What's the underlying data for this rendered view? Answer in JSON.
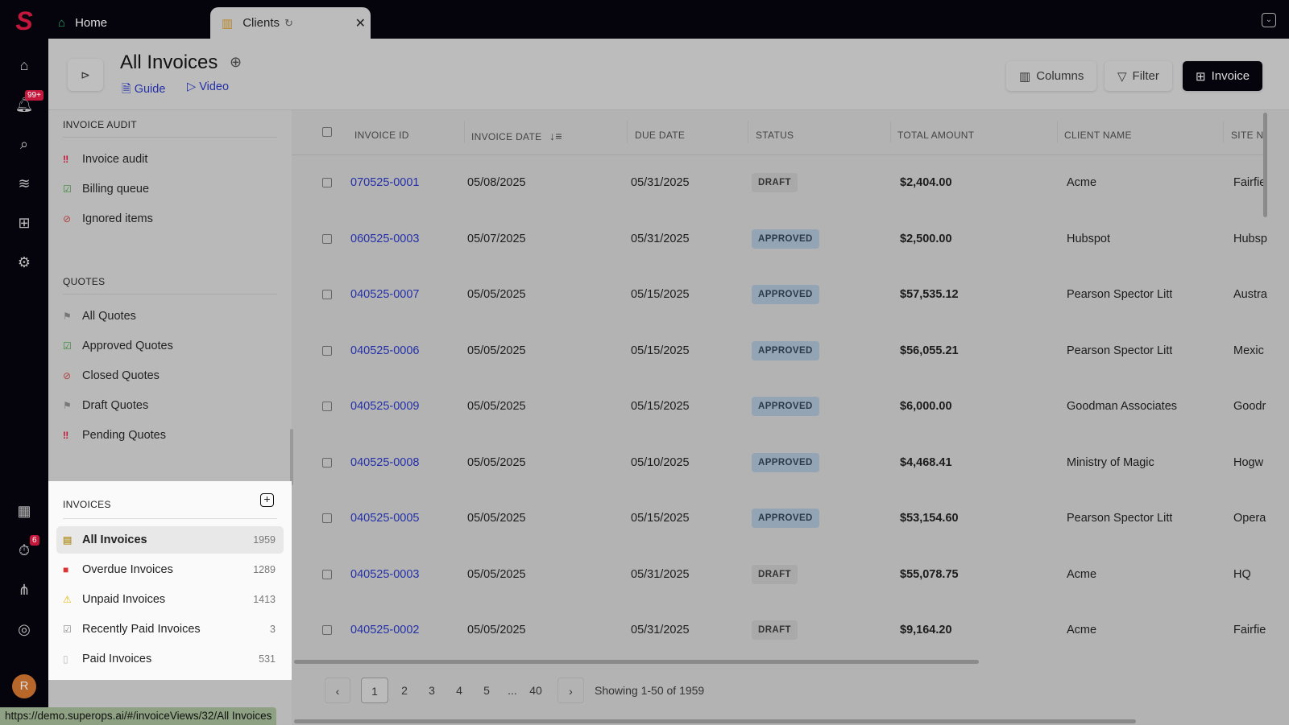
{
  "tabs": [
    {
      "label": "Home"
    },
    {
      "label": "Clients"
    }
  ],
  "rail": {
    "notif_badge": "99+",
    "timer_badge": "6",
    "avatar": "R"
  },
  "page": {
    "title": "All Invoices",
    "guide": "Guide",
    "video": "Video"
  },
  "toolbar": {
    "columns": "Columns",
    "filter": "Filter",
    "invoice": "Invoice"
  },
  "sidebar": {
    "audit_title": "INVOICE AUDIT",
    "audit": [
      {
        "label": "Invoice audit"
      },
      {
        "label": "Billing queue"
      },
      {
        "label": "Ignored items"
      }
    ],
    "quotes_title": "QUOTES",
    "quotes": [
      {
        "label": "All Quotes"
      },
      {
        "label": "Approved Quotes"
      },
      {
        "label": "Closed Quotes"
      },
      {
        "label": "Draft Quotes"
      },
      {
        "label": "Pending Quotes"
      }
    ],
    "invoices_title": "INVOICES",
    "invoices": [
      {
        "label": "All Invoices",
        "count": "1959"
      },
      {
        "label": "Overdue Invoices",
        "count": "1289"
      },
      {
        "label": "Unpaid Invoices",
        "count": "1413"
      },
      {
        "label": "Recently Paid Invoices",
        "count": "3"
      },
      {
        "label": "Paid Invoices",
        "count": "531"
      }
    ]
  },
  "table": {
    "headers": [
      "INVOICE ID",
      "INVOICE DATE",
      "DUE DATE",
      "STATUS",
      "TOTAL AMOUNT",
      "CLIENT NAME",
      "SITE NA"
    ],
    "rows": [
      {
        "id": "070525-0001",
        "date": "05/08/2025",
        "due": "05/31/2025",
        "status": "DRAFT",
        "total": "$2,404.00",
        "client": "Acme",
        "site": "Fairfie"
      },
      {
        "id": "060525-0003",
        "date": "05/07/2025",
        "due": "05/31/2025",
        "status": "APPROVED",
        "total": "$2,500.00",
        "client": "Hubspot",
        "site": "Hubsp"
      },
      {
        "id": "040525-0007",
        "date": "05/05/2025",
        "due": "05/15/2025",
        "status": "APPROVED",
        "total": "$57,535.12",
        "client": "Pearson Spector Litt",
        "site": "Austra"
      },
      {
        "id": "040525-0006",
        "date": "05/05/2025",
        "due": "05/15/2025",
        "status": "APPROVED",
        "total": "$56,055.21",
        "client": "Pearson Spector Litt",
        "site": "Mexic"
      },
      {
        "id": "040525-0009",
        "date": "05/05/2025",
        "due": "05/15/2025",
        "status": "APPROVED",
        "total": "$6,000.00",
        "client": "Goodman Associates",
        "site": "Goodr"
      },
      {
        "id": "040525-0008",
        "date": "05/05/2025",
        "due": "05/10/2025",
        "status": "APPROVED",
        "total": "$4,468.41",
        "client": "Ministry of Magic",
        "site": "Hogw"
      },
      {
        "id": "040525-0005",
        "date": "05/05/2025",
        "due": "05/15/2025",
        "status": "APPROVED",
        "total": "$53,154.60",
        "client": "Pearson Spector Litt",
        "site": "Opera"
      },
      {
        "id": "040525-0003",
        "date": "05/05/2025",
        "due": "05/31/2025",
        "status": "DRAFT",
        "total": "$55,078.75",
        "client": "Acme",
        "site": "HQ"
      },
      {
        "id": "040525-0002",
        "date": "05/05/2025",
        "due": "05/31/2025",
        "status": "DRAFT",
        "total": "$9,164.20",
        "client": "Acme",
        "site": "Fairfie"
      }
    ]
  },
  "pagination": {
    "pages": [
      "1",
      "2",
      "3",
      "4",
      "5",
      "...",
      "40"
    ],
    "summary": "Showing 1-50 of 1959"
  },
  "status_url": "https://demo.superops.ai/#/invoiceViews/32/All Invoices"
}
